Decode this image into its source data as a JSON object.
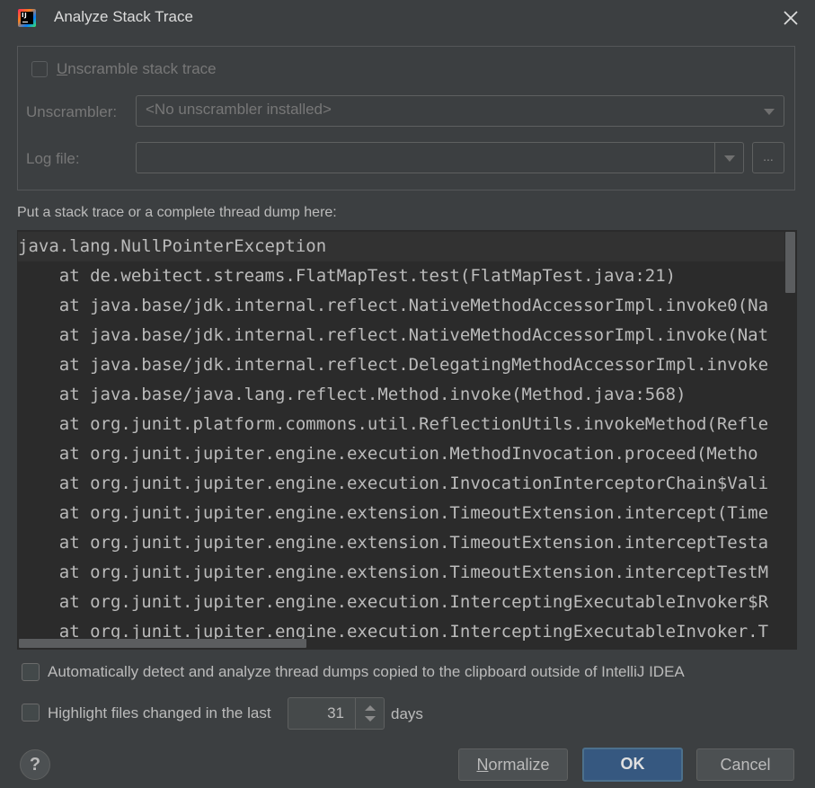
{
  "window": {
    "title": "Analyze Stack Trace",
    "app_icon": "intellij-idea-icon",
    "close_icon": "close-icon"
  },
  "group": {
    "unscramble_label_mnemonic": "U",
    "unscramble_label_rest": "nscramble stack trace",
    "unscramble_checked": false,
    "unscrambler_label": "Unscrambler:",
    "unscrambler_value": "<No unscrambler installed>",
    "logfile_label": "Log file:",
    "logfile_value": "",
    "browse_label": "..."
  },
  "trace": {
    "prompt": "Put a stack trace or a complete thread dump here:",
    "lines": [
      "java.lang.NullPointerException",
      "    at de.webitect.streams.FlatMapTest.test(FlatMapTest.java:21)",
      "    at java.base/jdk.internal.reflect.NativeMethodAccessorImpl.invoke0(Na",
      "    at java.base/jdk.internal.reflect.NativeMethodAccessorImpl.invoke(Nat",
      "    at java.base/jdk.internal.reflect.DelegatingMethodAccessorImpl.invoke",
      "    at java.base/java.lang.reflect.Method.invoke(Method.java:568)",
      "    at org.junit.platform.commons.util.ReflectionUtils.invokeMethod(Refle",
      "    at org.junit.jupiter.engine.execution.MethodInvocation.proceed(Metho",
      "    at org.junit.jupiter.engine.execution.InvocationInterceptorChain$Vali",
      "    at org.junit.jupiter.engine.extension.TimeoutExtension.intercept(Time",
      "    at org.junit.jupiter.engine.extension.TimeoutExtension.interceptTesta",
      "    at org.junit.jupiter.engine.extension.TimeoutExtension.interceptTestM",
      "    at org.junit.jupiter.engine.execution.InterceptingExecutableInvoker$R",
      "    at org.junit.jupiter.engine.execution.InterceptingExecutableInvoker.T"
    ]
  },
  "options": {
    "auto_detect_label": "Automatically detect and analyze thread dumps copied to the clipboard outside of IntelliJ IDEA",
    "auto_detect_checked": false,
    "highlight_label": "Highlight files changed in the last",
    "highlight_checked": false,
    "days_value": "31",
    "days_unit": "days"
  },
  "buttons": {
    "help": "?",
    "normalize_mnemonic": "N",
    "normalize_rest": "ormalize",
    "ok": "OK",
    "cancel": "Cancel"
  },
  "colors": {
    "background": "#3c3f41",
    "editor_background": "#2b2b2b",
    "default_button": "#365880"
  }
}
